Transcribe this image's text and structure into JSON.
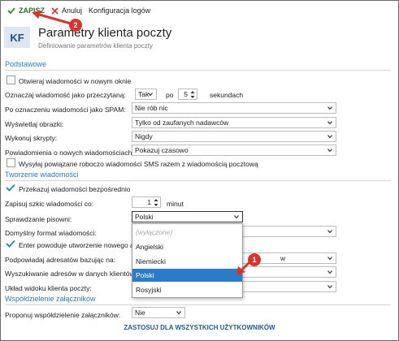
{
  "toolbar": {
    "save_label": "ZAPISZ",
    "cancel_label": "Anuluj",
    "config_label": "Konfiguracja logów"
  },
  "header": {
    "badge": "KF",
    "title": "Parametry klienta poczty",
    "subtitle": "Definiowanie parametrów klienta poczty"
  },
  "sections": {
    "basic": "Podstawowe",
    "compose": "Tworzenie wiadomości",
    "attachments": "Współdzielenie załączników"
  },
  "basic": {
    "open_new_window": "Otwieraj wiadomości w nowym oknie",
    "mark_read_label": "Oznaczaj wiadomość jako przeczytaną:",
    "mark_read_value": "Tak",
    "after_label": "po",
    "seconds_value": "5",
    "seconds_label": "sekundach",
    "spam_label": "Po oznaczeniu wiadomości jako SPAM:",
    "spam_value": "Nie rób nic",
    "images_label": "Wyświetlaj obrazki:",
    "images_value": "Tylko od zaufanych nadawców",
    "scripts_label": "Wykonuj skrypty:",
    "scripts_value": "Nigdy",
    "notify_label": "Powiadomienia o nowych wiadomościach:",
    "notify_value": "Pokazuj czasowo",
    "sms_label": "Wysyłaj powiązane roboczo wiadomości SMS razem z wiadomością pocztową"
  },
  "compose": {
    "forward_direct": "Przekazuj wiadomości bezpośrednio",
    "draft_label": "Zapisuj szkic wiadomości co:",
    "draft_value": "1",
    "draft_unit": "minut",
    "spell_label": "Sprawdzanie pisowni:",
    "spell_value": "Polski",
    "format_label": "Domyślny format wiadomości:",
    "enter_label": "Enter powoduje utworzenie nowego ak",
    "suggest_label": "Podpowiadaj adresatów bazując na:",
    "suggest_value_tail": "w",
    "search_label": "Wyszukiwanie adresów w danych klientów:",
    "layout_label": "Układ widoku klienta poczty:"
  },
  "spell_dropdown": {
    "options": [
      "(wyłączone)",
      "Angielski",
      "Niemiecki",
      "Polski",
      "Rosyjski"
    ],
    "selected": "Polski"
  },
  "attachments": {
    "propose_label": "Proponuj współdzielenie załączników:",
    "propose_value": "Nie"
  },
  "footer": {
    "apply_all": "ZASTOSUJ DLA WSZYSTKICH UŻYTKOWNIKÓW"
  },
  "annotations": {
    "step1": "1",
    "step2": "2"
  },
  "colors": {
    "accent": "#2e7abf",
    "save_green": "#2a6e2a",
    "cancel_red": "#d9332e",
    "badge_red": "#d9332e",
    "selected_blue": "#2b7bc6"
  }
}
